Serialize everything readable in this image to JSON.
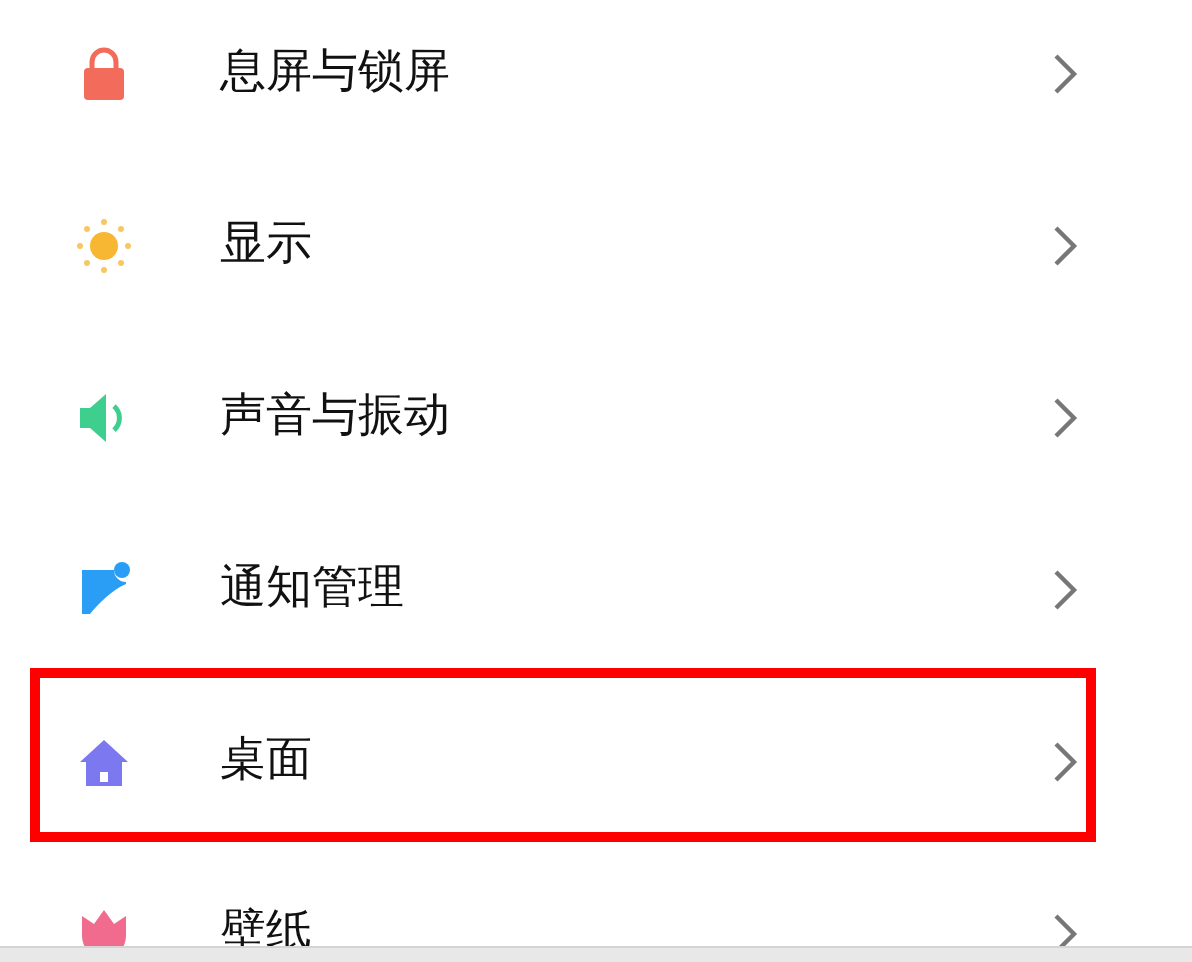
{
  "settings_items": [
    {
      "label": "息屏与锁屏",
      "kind": "lock",
      "highlighted": false
    },
    {
      "label": "显示",
      "kind": "sun",
      "highlighted": false
    },
    {
      "label": "声音与振动",
      "kind": "speaker",
      "highlighted": false
    },
    {
      "label": "通知管理",
      "kind": "notification",
      "highlighted": false
    },
    {
      "label": "桌面",
      "kind": "home",
      "highlighted": true
    },
    {
      "label": "壁纸",
      "kind": "flower",
      "highlighted": false
    }
  ]
}
